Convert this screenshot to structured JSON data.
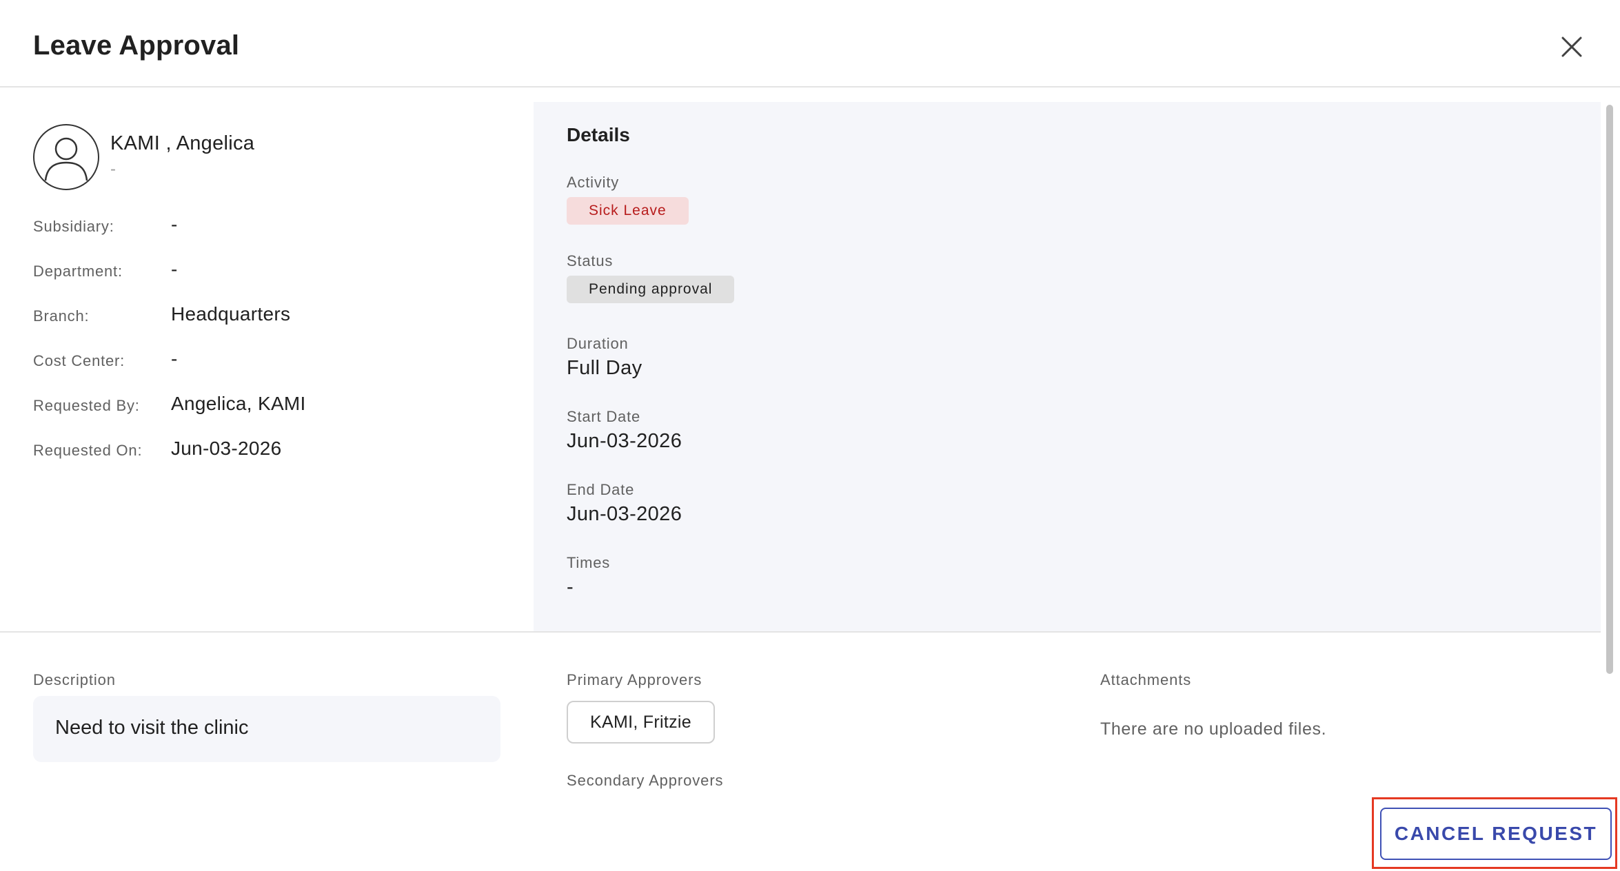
{
  "header": {
    "title": "Leave Approval"
  },
  "employee": {
    "name": "KAMI , Angelica",
    "subtitle": "-"
  },
  "info": [
    {
      "label": "Subsidiary:",
      "value": "-"
    },
    {
      "label": "Department:",
      "value": "-"
    },
    {
      "label": "Branch:",
      "value": "Headquarters"
    },
    {
      "label": "Cost Center:",
      "value": "-"
    },
    {
      "label": "Requested By:",
      "value": "Angelica, KAMI"
    },
    {
      "label": "Requested On:",
      "value": "Jun-03-2026"
    }
  ],
  "details": {
    "title": "Details",
    "activity_label": "Activity",
    "activity_value": "Sick Leave",
    "status_label": "Status",
    "status_value": "Pending approval",
    "duration_label": "Duration",
    "duration_value": "Full Day",
    "start_label": "Start Date",
    "start_value": "Jun-03-2026",
    "end_label": "End Date",
    "end_value": "Jun-03-2026",
    "times_label": "Times",
    "times_value": "-"
  },
  "bottom": {
    "description_label": "Description",
    "description_text": "Need to visit the clinic",
    "primary_approvers_label": "Primary Approvers",
    "primary_approvers": [
      "KAMI, Fritzie"
    ],
    "secondary_approvers_label": "Secondary Approvers",
    "attachments_label": "Attachments",
    "attachments_empty": "There are no uploaded files."
  },
  "actions": {
    "cancel_label": "CANCEL REQUEST"
  },
  "colors": {
    "accent": "#3949ab",
    "highlight": "#e53922",
    "sick_chip_bg": "#f6dcdc",
    "sick_chip_text": "#b71c1c",
    "panel_bg": "#f5f6fa"
  },
  "icons": {
    "close": "close-icon",
    "avatar": "user-avatar-icon"
  }
}
